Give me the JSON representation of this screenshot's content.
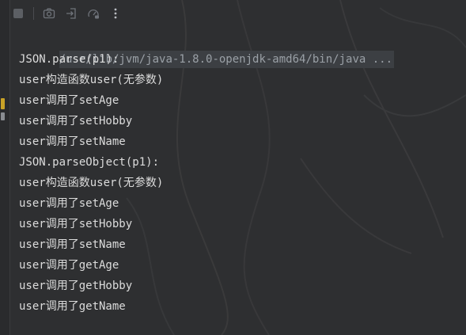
{
  "toolbar": {
    "icons": [
      "stop-icon",
      "camera-icon",
      "login-icon",
      "dashboard-icon",
      "more-vertical-icon"
    ]
  },
  "console": {
    "command": "/usr/lib/jvm/java-1.8.0-openjdk-amd64/bin/java ...",
    "lines": [
      "JSON.parse(p1):",
      "user构造函数user(无参数)",
      "user调用了setAge",
      "user调用了setHobby",
      "user调用了setName",
      "JSON.parseObject(p1):",
      "user构造函数user(无参数)",
      "user调用了setAge",
      "user调用了setHobby",
      "user调用了setName",
      "user调用了getAge",
      "user调用了getHobby",
      "user调用了getName"
    ]
  },
  "colors": {
    "background": "#2e2f31",
    "text": "#dcdcdc",
    "command_text": "#9aa0a6",
    "command_highlight": "#3c3f43",
    "gutter_marker": "#c9a227"
  }
}
